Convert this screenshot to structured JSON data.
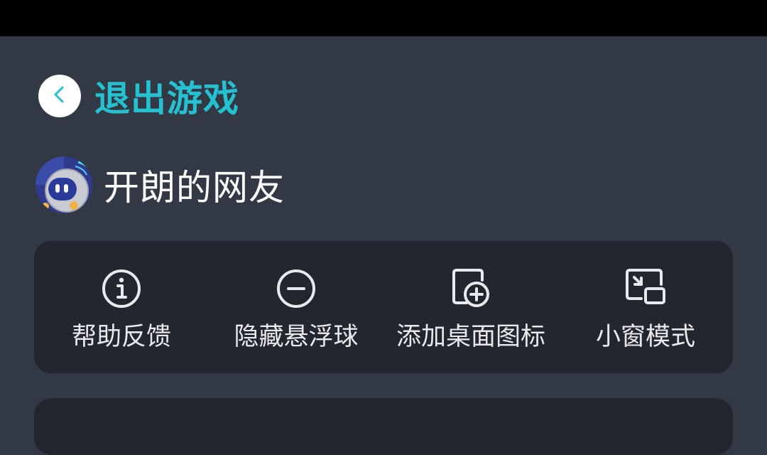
{
  "header": {
    "back_icon": "chevron-left-icon",
    "title": "退出游戏"
  },
  "user": {
    "name": "开朗的网友",
    "avatar_icon": "robot-avatar"
  },
  "actions": [
    {
      "label": "帮助反馈",
      "icon": "info-circle-icon"
    },
    {
      "label": "隐藏悬浮球",
      "icon": "minus-circle-icon"
    },
    {
      "label": "添加桌面图标",
      "icon": "add-shortcut-icon"
    },
    {
      "label": "小窗模式",
      "icon": "picture-in-picture-icon"
    }
  ],
  "colors": {
    "background": "#333845",
    "card": "#24262f",
    "accent": "#25c1d0",
    "text": "#ffffff"
  }
}
